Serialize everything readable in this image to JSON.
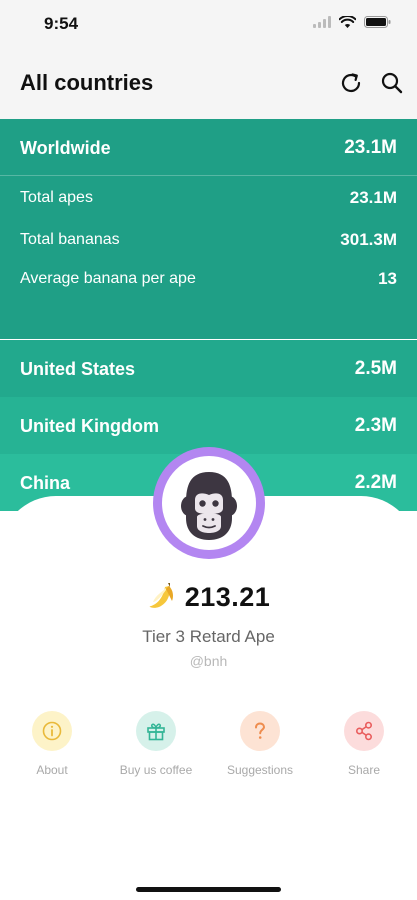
{
  "status": {
    "time": "9:54"
  },
  "nav": {
    "title": "All countries",
    "refresh_icon": "refresh-icon",
    "search_icon": "search-icon"
  },
  "worldwide": {
    "label": "Worldwide",
    "value": "23.1M",
    "stats": [
      {
        "label": "Total apes",
        "value": "23.1M"
      },
      {
        "label": "Total bananas",
        "value": "301.3M"
      },
      {
        "label": "Average banana per ape",
        "value": "13"
      }
    ]
  },
  "countries": [
    {
      "name": "United States",
      "value": "2.5M",
      "color": "#22a98d"
    },
    {
      "name": "United Kingdom",
      "value": "2.3M",
      "color": "#26b394"
    },
    {
      "name": "China",
      "value": "2.2M",
      "color": "#2bbd9c"
    }
  ],
  "profile": {
    "avatar_icon": "gorilla-avatar",
    "balance": "213.21",
    "tier": "Tier 3 Retard Ape",
    "handle": "@bnh"
  },
  "actions": [
    {
      "label": "About",
      "icon": "info-icon",
      "bg": "#fdf3c8",
      "fg": "#e9b93a"
    },
    {
      "label": "Buy us coffee",
      "icon": "gift-icon",
      "bg": "#d6f1ea",
      "fg": "#33b596"
    },
    {
      "label": "Suggestions",
      "icon": "question-icon",
      "bg": "#fde3d4",
      "fg": "#ee8c4e"
    },
    {
      "label": "Share",
      "icon": "share-icon",
      "bg": "#fcdcdc",
      "fg": "#e95c5c"
    }
  ],
  "colors": {
    "primary": "#1f9f86",
    "avatar_ring": "#b386f1"
  }
}
